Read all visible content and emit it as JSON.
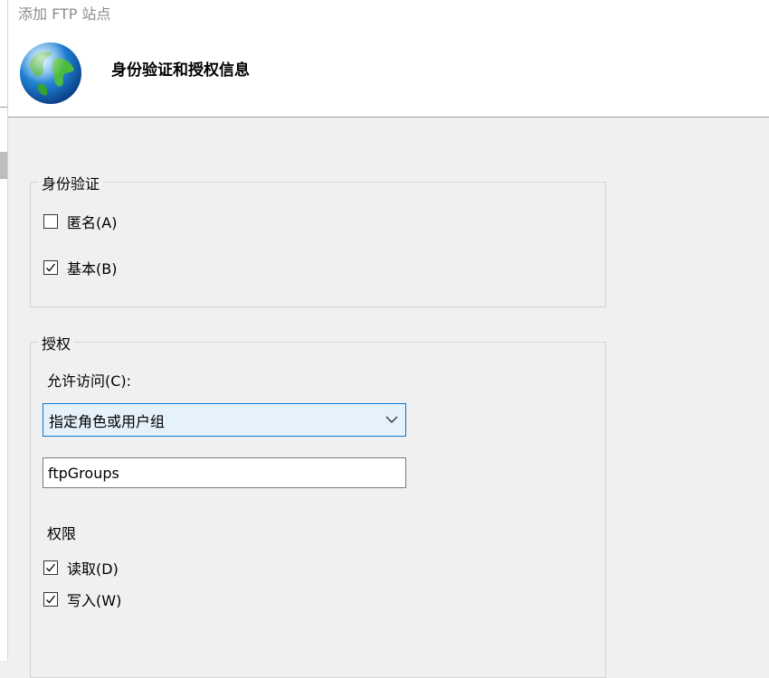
{
  "window": {
    "title": "添加 FTP 站点"
  },
  "header": {
    "title": "身份验证和授权信息",
    "icon": "globe-icon"
  },
  "authentication": {
    "legend": "身份验证",
    "anonymous": {
      "label": "匿名(A)",
      "checked": false
    },
    "basic": {
      "label": "基本(B)",
      "checked": true
    }
  },
  "authorization": {
    "legend": "授权",
    "allow_access_label": "允许访问(C):",
    "allow_access_value": "指定角色或用户组",
    "roles_value": "ftpGroups",
    "permissions_label": "权限",
    "read": {
      "label": "读取(D)",
      "checked": true
    },
    "write": {
      "label": "写入(W)",
      "checked": true
    }
  },
  "colors": {
    "accent": "#0078d7",
    "dropdown_bg": "#e5f1fb",
    "dialog_bg": "#f0f0f0"
  }
}
